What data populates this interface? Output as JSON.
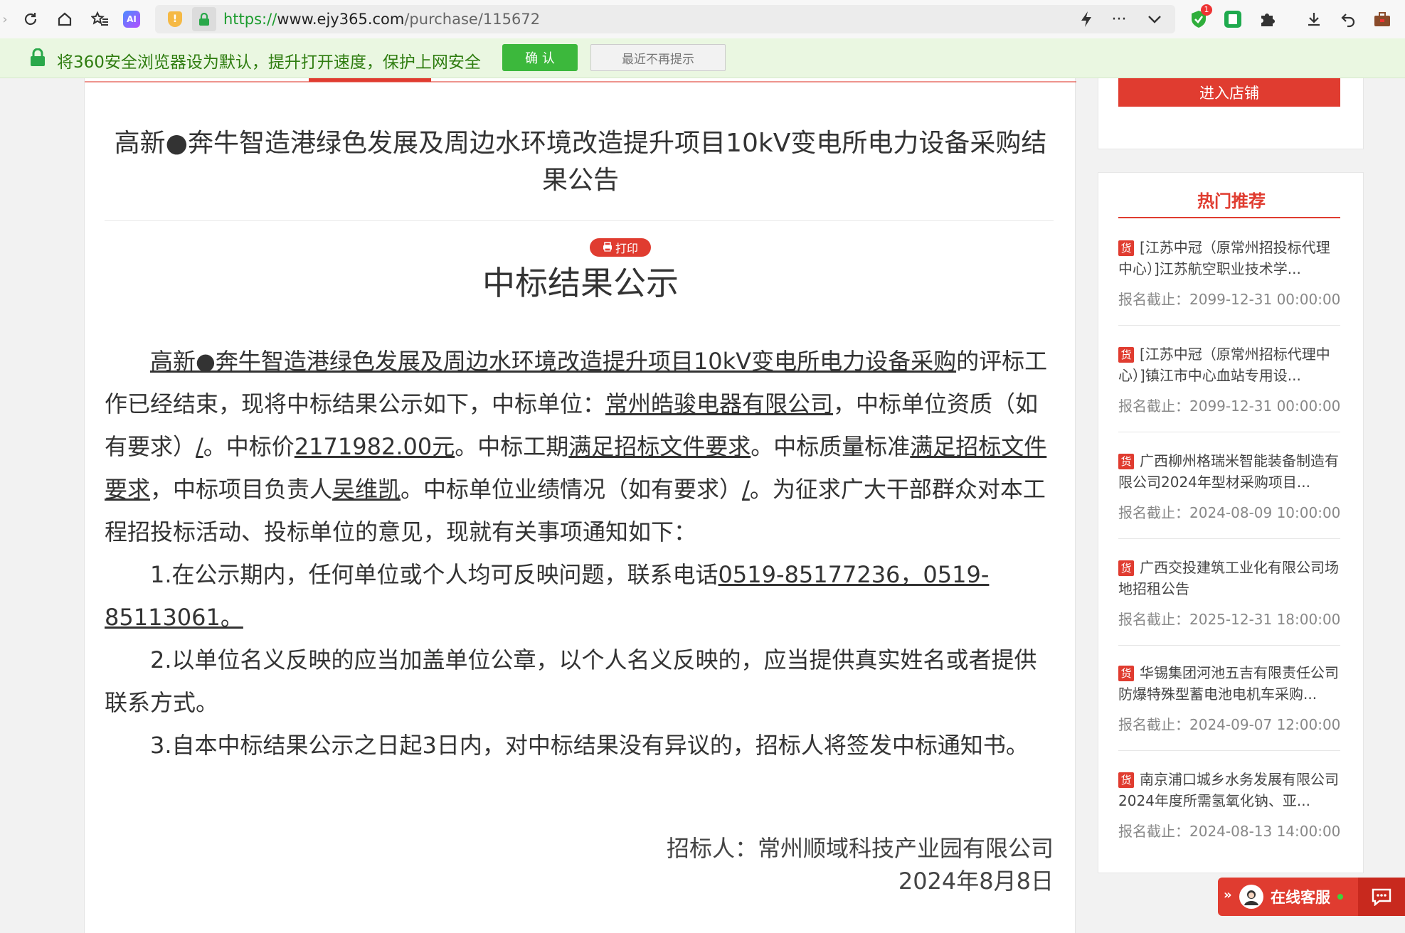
{
  "browser": {
    "url_proto": "https://",
    "url_host": "www.ejy365.com",
    "url_path": "/purchase/115672"
  },
  "notification": {
    "text": "将360安全浏览器设为默认，提升打开速度，保护上网安全",
    "confirm_label": "确 认",
    "noremind_label": "最近不再提示"
  },
  "article": {
    "title": "高新●奔牛智造港绿色发展及周边水环境改造提升项目10kV变电所电力设备采购结果公告",
    "print_label": "打印",
    "subtitle": "中标结果公示",
    "p1": {
      "project_link": "高新●奔牛智造港绿色发展及周边水环境改造提升项目10kV变电所电力设备采购",
      "t1": "的评标工作已经结束，现将中标结果公示如下，中标单位：",
      "winner": "常州皓骏电器有限公司",
      "t2": "，中标单位资质（如有要求）",
      "qual": "/",
      "t3": "。中标价",
      "price": "2171982.00元",
      "t4": "。中标工期",
      "period": "满足招标文件要求",
      "t5": "。中标质量标准",
      "quality": "满足招标文件要求",
      "t6": "，中标项目负责人",
      "manager": "吴维凯",
      "t7": "。中标单位业绩情况（如有要求）",
      "perf": "/",
      "t8": "。为征求广大干部群众对本工程招投标活动、投标单位的意见，现就有关事项通知如下："
    },
    "p2": {
      "t1": "1.在公示期内，任何单位或个人均可反映问题，联系电话",
      "phone": "0519-85177236，0519-85113061。"
    },
    "p3": "2.以单位名义反映的应当加盖单位公章，以个人名义反映的，应当提供真实姓名或者提供联系方式。",
    "p4": "3.自本中标结果公示之日起3日内，对中标结果没有异议的，招标人将签发中标通知书。",
    "signer": "招标人：常州顺域科技产业园有限公司",
    "date": "2024年8月8日"
  },
  "sidebar": {
    "store_button": "进入店铺",
    "hot_title": "热门推荐",
    "tag": "货",
    "items": [
      {
        "title": "[江苏中冠（原常州招投标代理中心）]江苏航空职业技术学...",
        "date": "报名截止：2099-12-31 00:00:00"
      },
      {
        "title": "[江苏中冠（原常州招标代理中心）]镇江市中心血站专用设...",
        "date": "报名截止：2099-12-31 00:00:00"
      },
      {
        "title": "广西柳州格瑞米智能装备制造有限公司2024年型材采购项目...",
        "date": "报名截止：2024-08-09 10:00:00"
      },
      {
        "title": "广西交投建筑工业化有限公司场地招租公告",
        "date": "报名截止：2025-12-31 18:00:00"
      },
      {
        "title": "华锡集团河池五吉有限责任公司防爆特殊型蓄电池电机车采购...",
        "date": "报名截止：2024-09-07 12:00:00"
      },
      {
        "title": "南京浦口城乡水务发展有限公司2024年度所需氢氧化钠、亚...",
        "date": "报名截止：2024-08-13 14:00:00"
      }
    ]
  },
  "service": {
    "label": "在线客服"
  },
  "colors": {
    "accent": "#e03c30",
    "notif_green": "#2f7d10",
    "url_green": "#1a9b2c"
  }
}
